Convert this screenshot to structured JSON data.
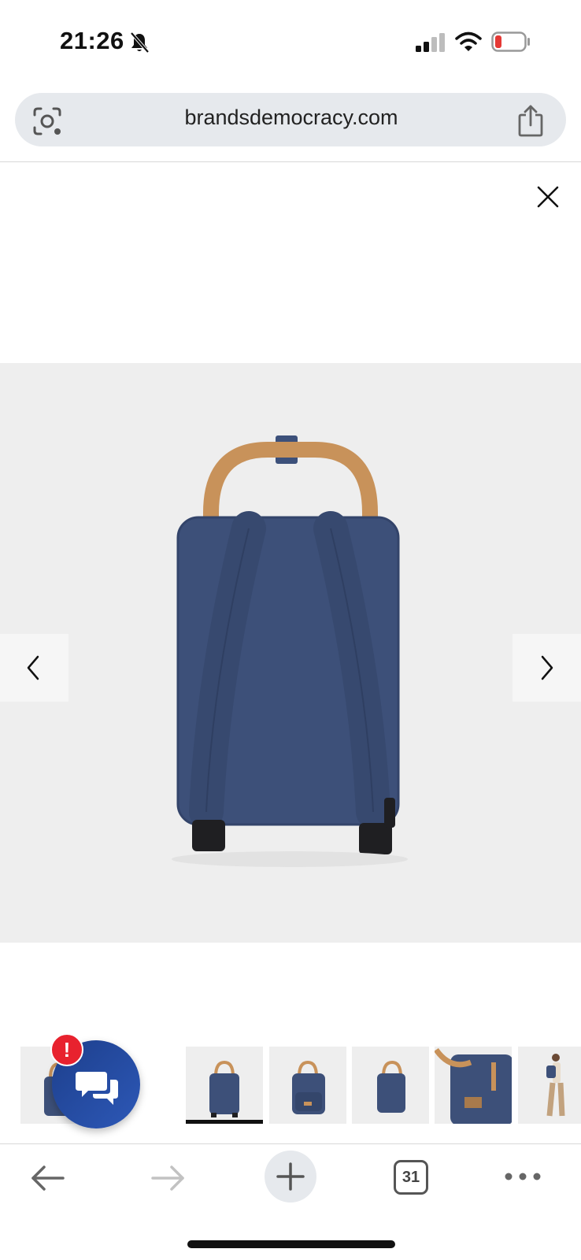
{
  "status_bar": {
    "time": "21:26",
    "icons": [
      "bell-slash-icon",
      "cellular-signal-icon",
      "wifi-icon",
      "battery-low-icon"
    ],
    "battery_color": "#e53935"
  },
  "browser": {
    "url": "brandsdemocracy.com",
    "tab_count": "31"
  },
  "gallery": {
    "close_icon": "close-icon",
    "prev_icon": "chevron-left-icon",
    "next_icon": "chevron-right-icon",
    "main_image": "backpack-back-view",
    "thumbnails": [
      {
        "name": "backpack-front"
      },
      {
        "name": "backpack-back",
        "selected": true
      },
      {
        "name": "backpack-angled"
      },
      {
        "name": "backpack-side"
      },
      {
        "name": "backpack-detail"
      },
      {
        "name": "backpack-worn"
      }
    ]
  },
  "chat": {
    "badge": "!",
    "badge_color": "#e8222e",
    "button_color": "#2548a0"
  },
  "colors": {
    "backpack_blue": "#3c507a",
    "strap_tan": "#c8925a"
  }
}
